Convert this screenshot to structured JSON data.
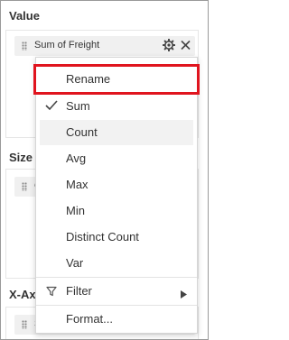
{
  "sections": {
    "value": {
      "title": "Value"
    },
    "size": {
      "title": "Size",
      "pill_initial": "C"
    },
    "x_axis": {
      "title": "X-Ax",
      "pill_initial": "S"
    }
  },
  "value_pill": {
    "label": "Sum of Freight",
    "settings_icon": "gear-icon",
    "remove_icon": "close-icon"
  },
  "menu": {
    "rename": "Rename",
    "sum": "Sum",
    "count": "Count",
    "avg": "Avg",
    "max": "Max",
    "min": "Min",
    "distinct_count": "Distinct Count",
    "var": "Var",
    "filter": "Filter",
    "format": "Format...",
    "selected": "Sum",
    "hovered": "Count",
    "focused": "Rename"
  },
  "colors": {
    "focus_outline": "#e0141e",
    "hover_bg": "#f2f2f2"
  }
}
